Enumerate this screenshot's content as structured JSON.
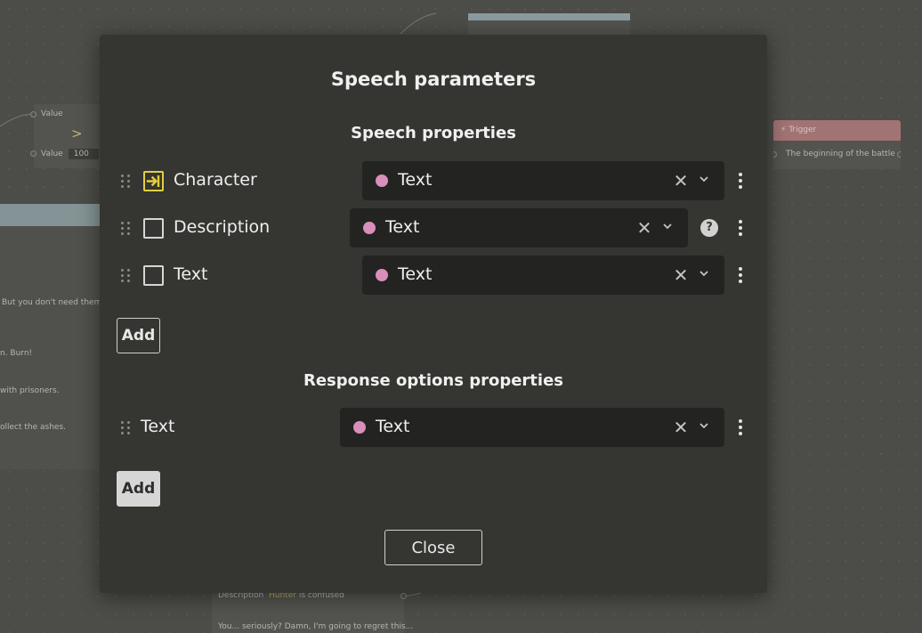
{
  "background": {
    "compare_node": {
      "value_label_1": "Value",
      "operator": ">",
      "value_label_2": "Value",
      "value": "100"
    },
    "left_texts": [
      "But you don't need them,",
      "n. Burn!",
      "with prisoners.",
      "ollect the ashes."
    ],
    "trigger_node": {
      "title": "Trigger",
      "text": "The beginning of the battle",
      "color": "#b98383"
    },
    "desc_node": {
      "label": "Description",
      "character": "Hunter",
      "text": "is confused",
      "quote": "You... seriously? Damn, I'm going to regret this..."
    }
  },
  "modal": {
    "title": "Speech parameters",
    "speech_section": {
      "title": "Speech properties",
      "rows": [
        {
          "label": "Character",
          "checkbox": "key",
          "type": "Text",
          "help": false
        },
        {
          "label": "Description",
          "checkbox": "empty",
          "type": "Text",
          "help": true
        },
        {
          "label": "Text",
          "checkbox": "empty",
          "type": "Text",
          "help": false
        }
      ],
      "add_label": "Add"
    },
    "response_section": {
      "title": "Response options properties",
      "rows": [
        {
          "label": "Text",
          "type": "Text"
        }
      ],
      "add_label": "Add"
    },
    "close_label": "Close",
    "type_dot_color": "#d98fb9",
    "key_color": "#e2cf3f"
  }
}
